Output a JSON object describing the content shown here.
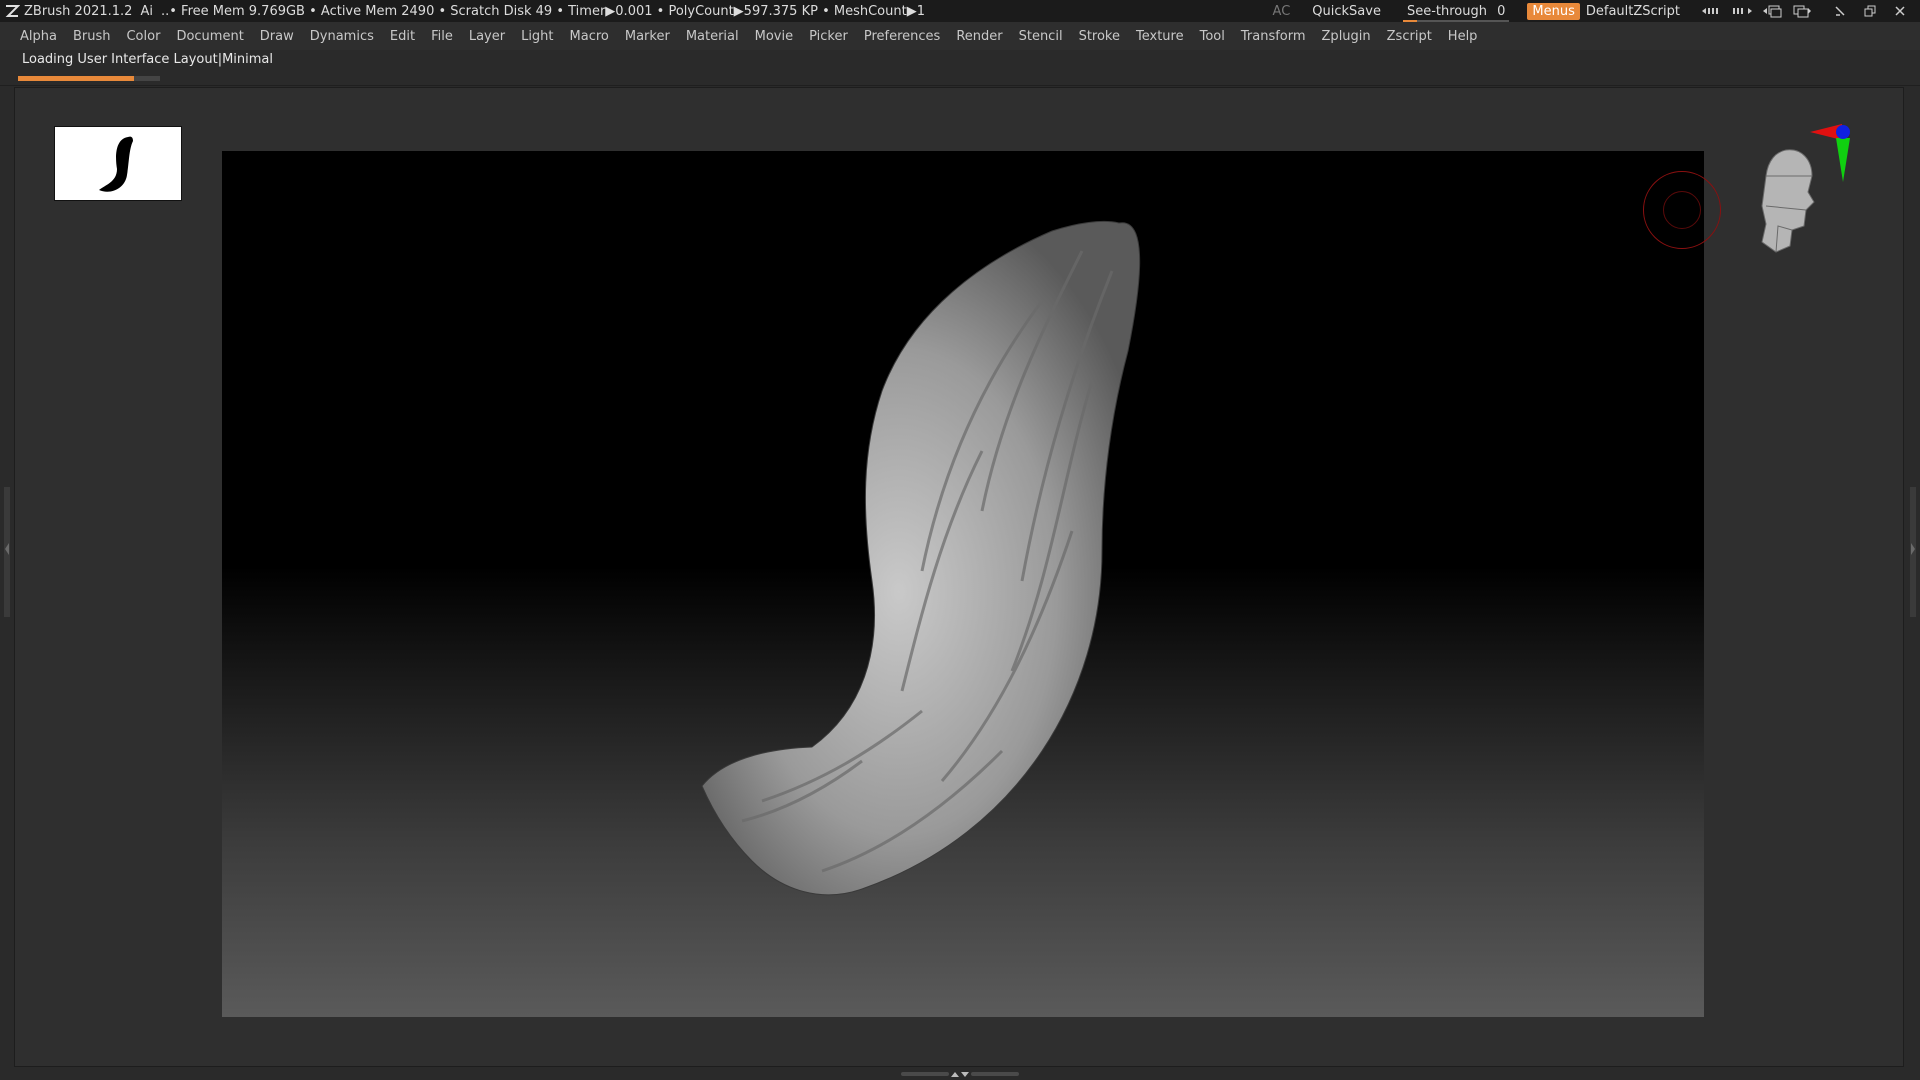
{
  "app": {
    "title": "ZBrush 2021.1.2",
    "ai_label": "Ai",
    "status": "..• Free Mem 9.769GB • Active Mem 2490 • Scratch Disk 49 • Timer▶0.001 • PolyCount▶597.375 KP • MeshCount▶1"
  },
  "toolbar_right": {
    "ac_label": "AC",
    "quicksave_label": "QuickSave",
    "seethrough_label": "See-through",
    "seethrough_value": "0",
    "menus_label": "Menus",
    "script_label": "DefaultZScript"
  },
  "menu": {
    "items": [
      "Alpha",
      "Brush",
      "Color",
      "Document",
      "Draw",
      "Dynamics",
      "Edit",
      "File",
      "Layer",
      "Light",
      "Macro",
      "Marker",
      "Material",
      "Movie",
      "Picker",
      "Preferences",
      "Render",
      "Stencil",
      "Stroke",
      "Texture",
      "Tool",
      "Transform",
      "Zplugin",
      "Zscript",
      "Help"
    ]
  },
  "loading": {
    "label": "Loading User Interface Layout|Minimal",
    "progress_fraction": 0.82
  },
  "icons": {
    "logo": "zbrush-logo-icon",
    "brush_thumb": "brush-stroke-icon",
    "rotation_gizmo": "rotation-gizmo-icon",
    "nav_head": "navigation-head-icon",
    "axis": "xyz-axis-icon"
  },
  "colors": {
    "accent": "#e8893a",
    "axis_x": "#e01010",
    "axis_y": "#10d010",
    "axis_z": "#1020e0"
  }
}
